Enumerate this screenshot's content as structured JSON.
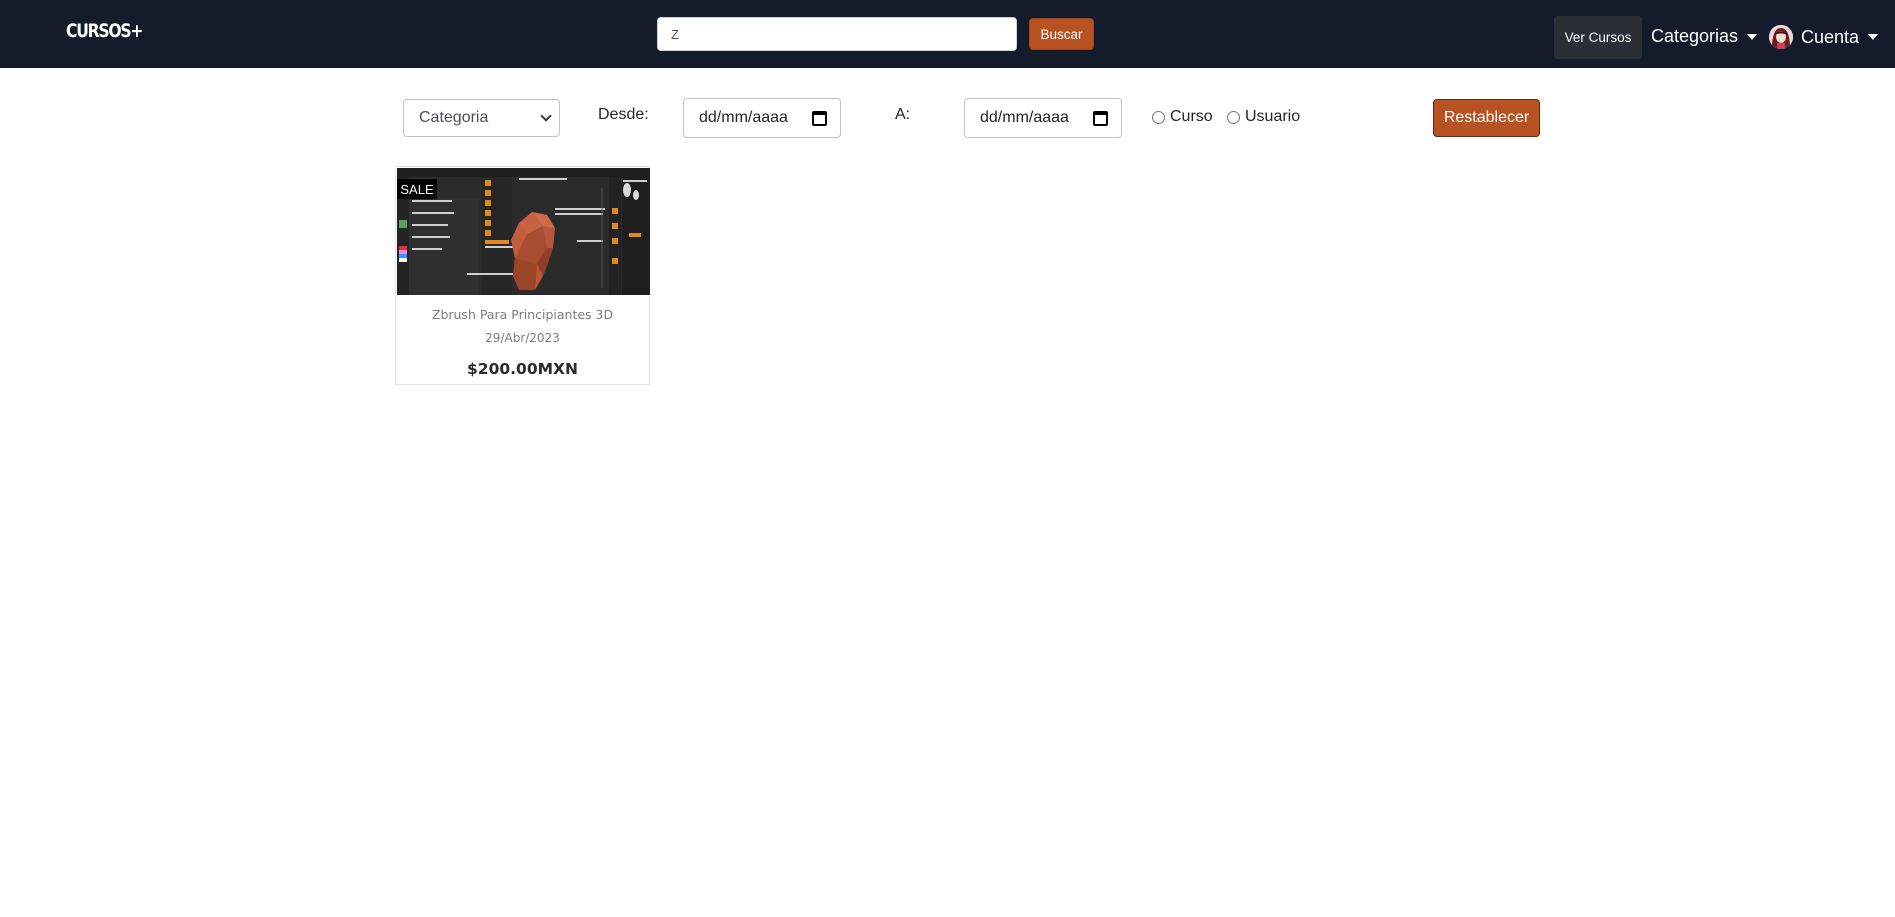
{
  "header": {
    "brand": "CURSOS+",
    "search": {
      "value": "Z",
      "placeholder": ""
    },
    "search_button": "Buscar",
    "ver_cursos": "Ver Cursos",
    "categorias": "Categorias",
    "account": "Cuenta"
  },
  "filters": {
    "category_select": "Categoria",
    "from_label": "Desde:",
    "from_value": "dd/mm/aaaa",
    "to_label": "A:",
    "to_value": "dd/mm/aaaa",
    "radio_course": "Curso",
    "radio_user": "Usuario",
    "reset_button": "Restablecer"
  },
  "courses": [
    {
      "badge": "SALE",
      "title": "Zbrush Para Principiantes 3D",
      "date": "29/Abr/2023",
      "price": "$200.00MXN"
    }
  ],
  "colors": {
    "navbar": "#141c2c",
    "accent": "#b95222",
    "ver_cursos_bg": "#2a2f37"
  }
}
